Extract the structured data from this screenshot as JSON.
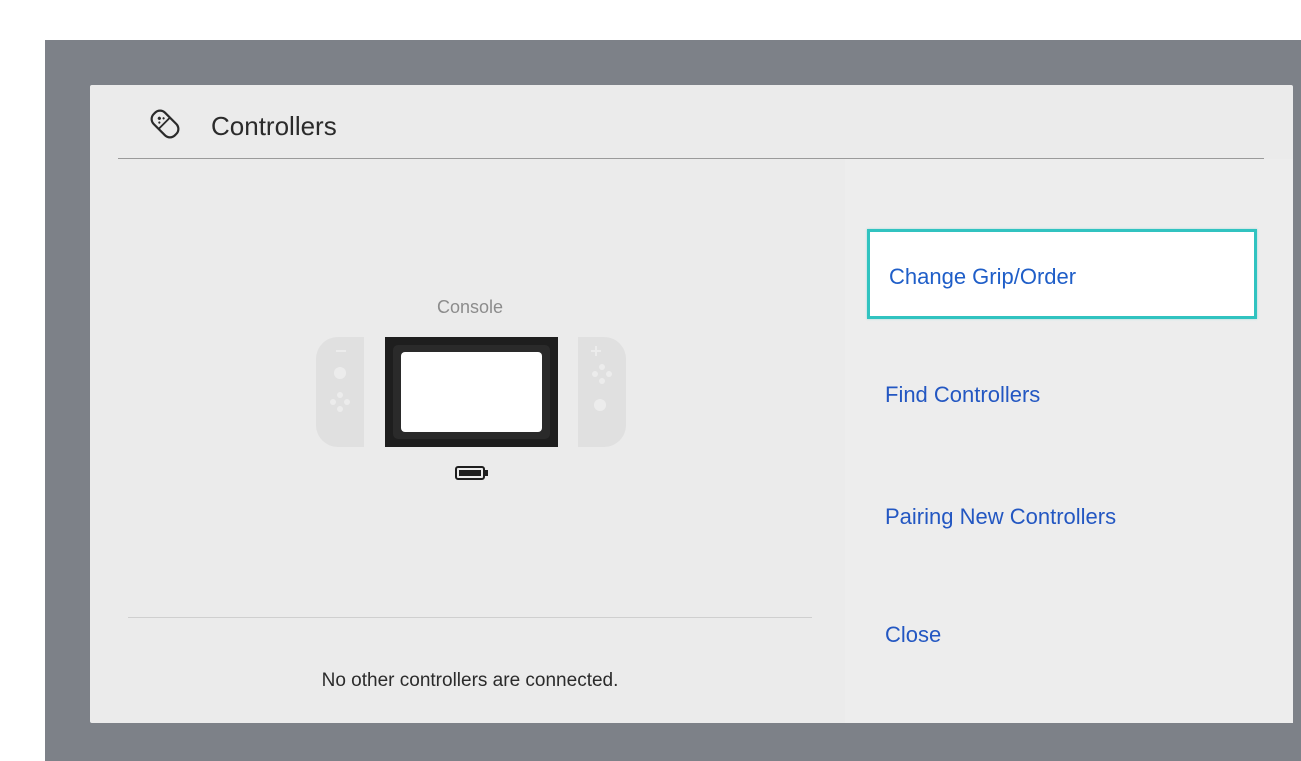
{
  "dialog": {
    "title": "Controllers",
    "icon": "controller-icon"
  },
  "console": {
    "label": "Console",
    "battery_icon": "battery-icon"
  },
  "status": {
    "message": "No other controllers are connected."
  },
  "menu": {
    "items": [
      {
        "label": "Change Grip/Order",
        "selected": true
      },
      {
        "label": "Find Controllers",
        "selected": false
      },
      {
        "label": "Pairing New Controllers",
        "selected": false
      },
      {
        "label": "Close",
        "selected": false
      }
    ]
  },
  "colors": {
    "backdrop": "#7d8188",
    "dialog": "#ebebeb",
    "accent_text": "#1f5ec8",
    "selection_border": "#31c3c0"
  }
}
